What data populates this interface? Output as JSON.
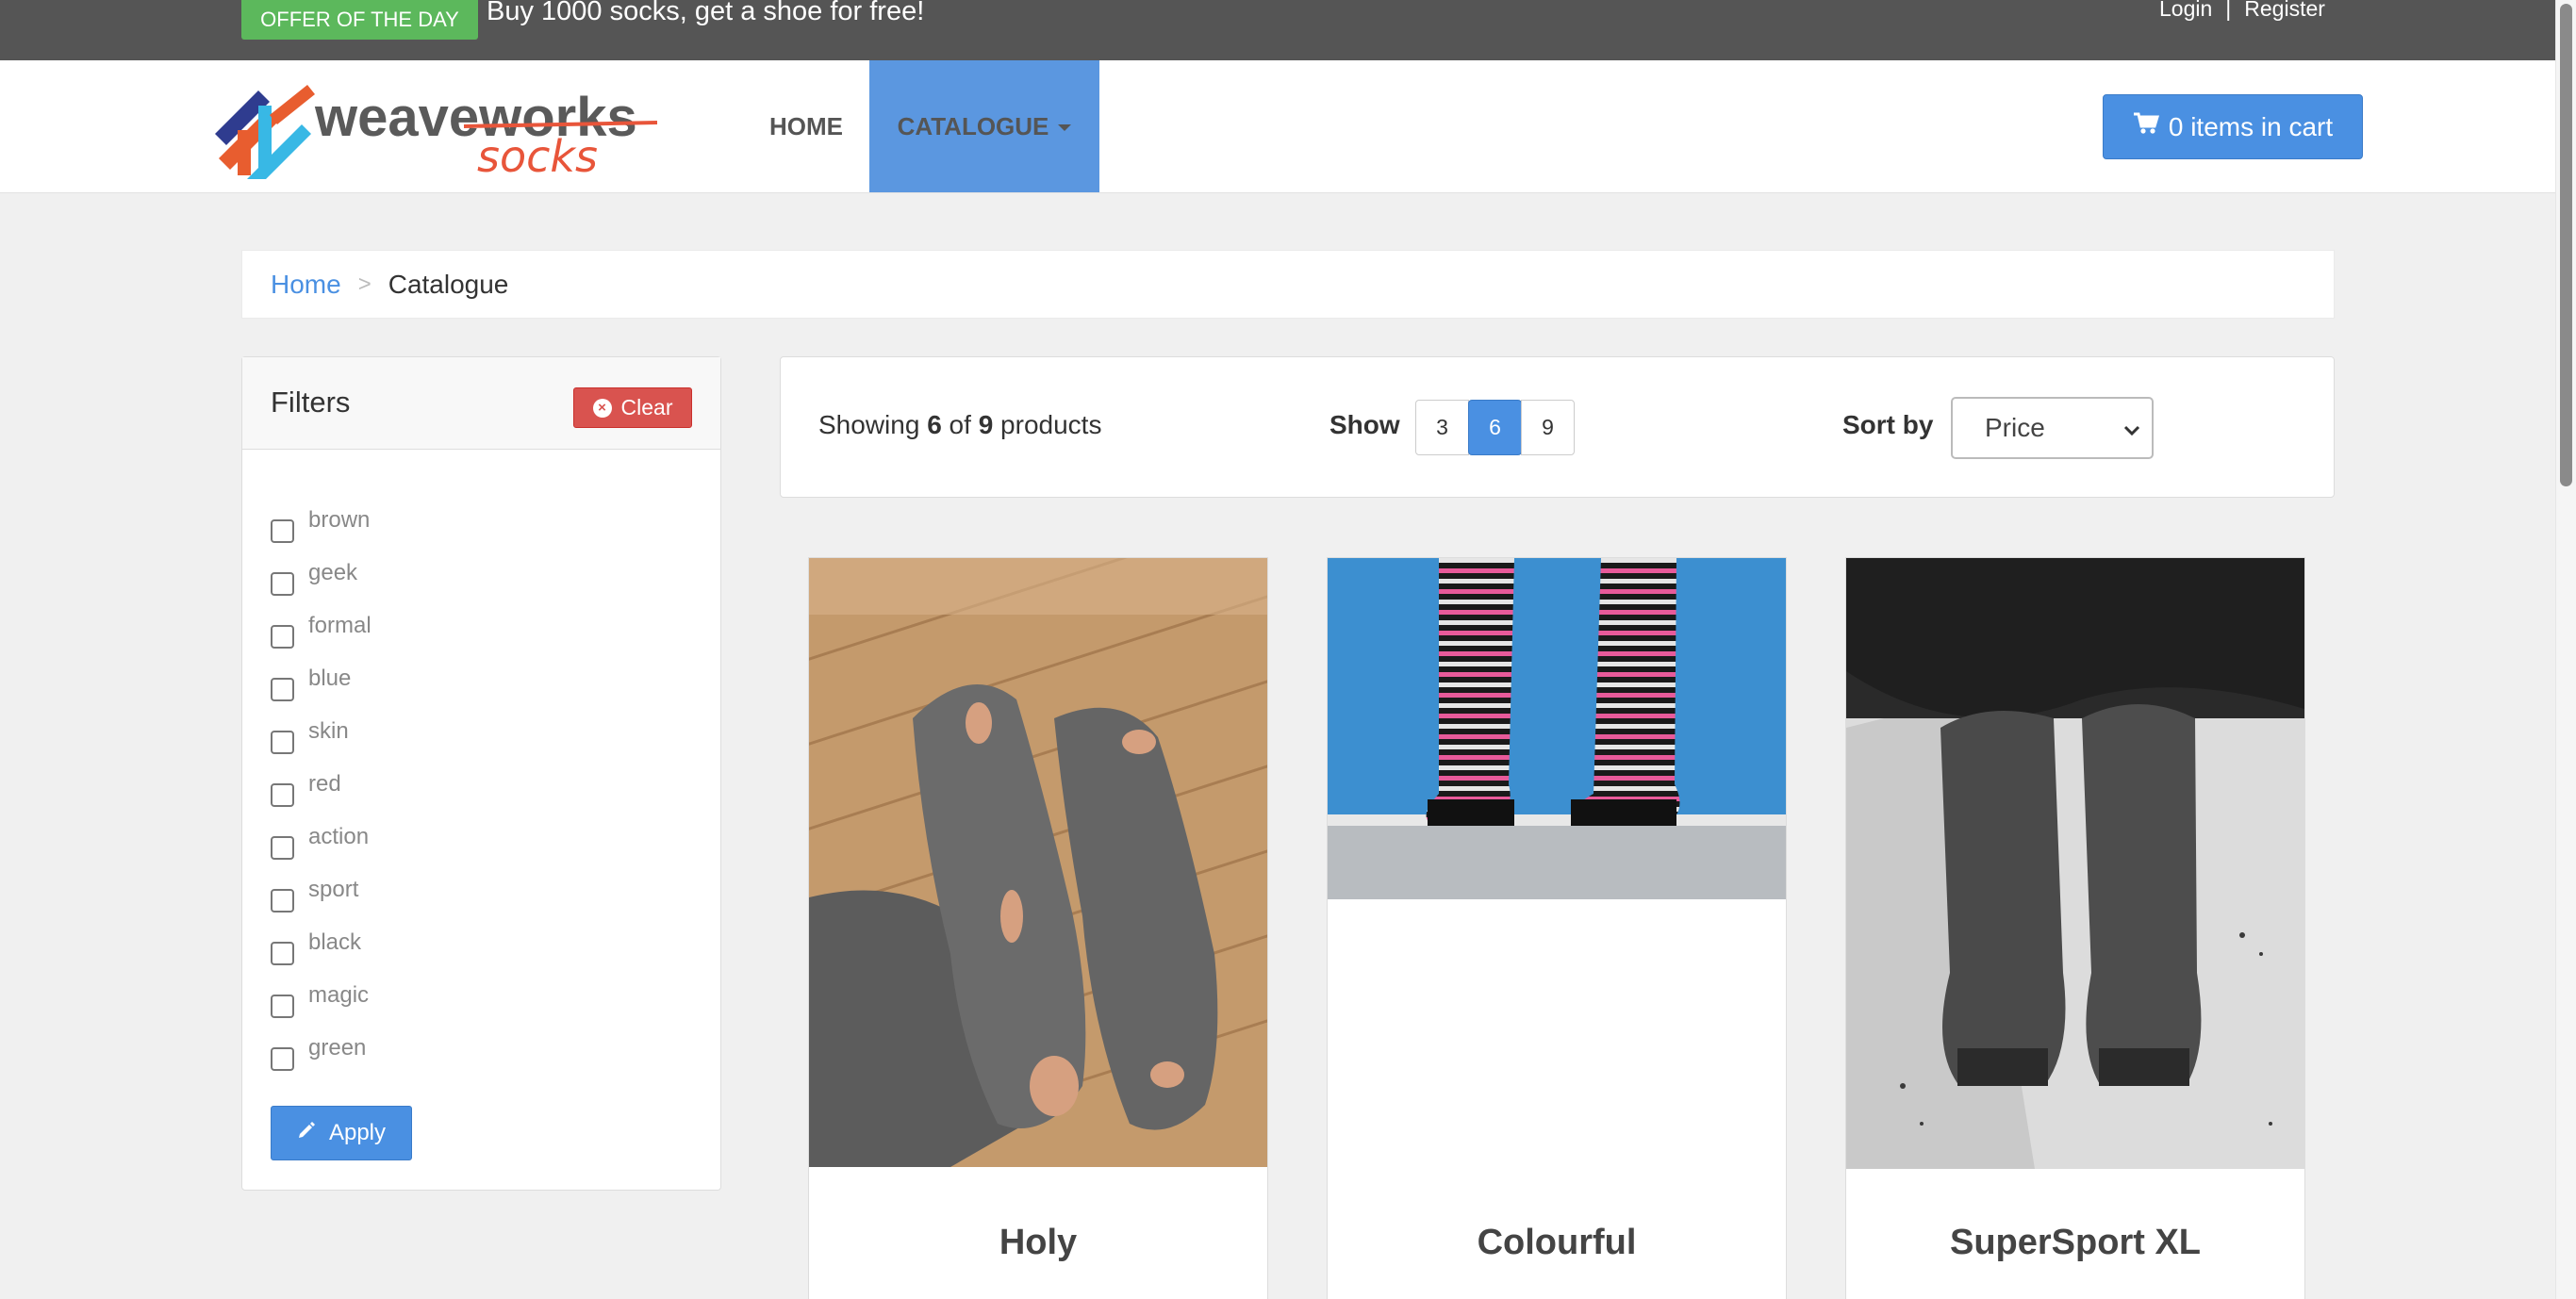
{
  "topbar": {
    "offer_badge": "OFFER OF THE DAY",
    "offer_text": "Buy 1000 socks, get a shoe for free!",
    "login": "Login",
    "separator": "|",
    "register": "Register"
  },
  "navbar": {
    "logo_text_primary": "weaveworks",
    "logo_text_secondary": "socks",
    "home": "HOME",
    "catalogue": "CATALOGUE",
    "cart": "0 items in cart"
  },
  "breadcrumb": {
    "home": "Home",
    "separator": ">",
    "current": "Catalogue"
  },
  "filters": {
    "title": "Filters",
    "clear": "Clear",
    "apply": "Apply",
    "items": [
      "brown",
      "geek",
      "formal",
      "blue",
      "skin",
      "red",
      "action",
      "sport",
      "black",
      "magic",
      "green"
    ]
  },
  "toolbar": {
    "showing_prefix": "Showing",
    "showing_count": "6",
    "showing_of": "of",
    "showing_total": "9",
    "showing_suffix": "products",
    "show_label": "Show",
    "page_sizes": [
      "3",
      "6",
      "9"
    ],
    "active_page_size": "6",
    "sort_label": "Sort by",
    "sort_value": "Price"
  },
  "products": [
    {
      "name": "Holy"
    },
    {
      "name": "Colourful"
    },
    {
      "name": "SuperSport XL"
    }
  ],
  "colors": {
    "topbar": "#555555",
    "offer_badge": "#5cb85c",
    "primary": "#4a90e2",
    "catalogue_active": "#5b97e0",
    "danger": "#d9534f"
  },
  "icons": {
    "cart": "shopping-cart-icon",
    "clear": "times-circle-icon",
    "apply": "pencil-icon",
    "caret": "caret-down-icon"
  }
}
